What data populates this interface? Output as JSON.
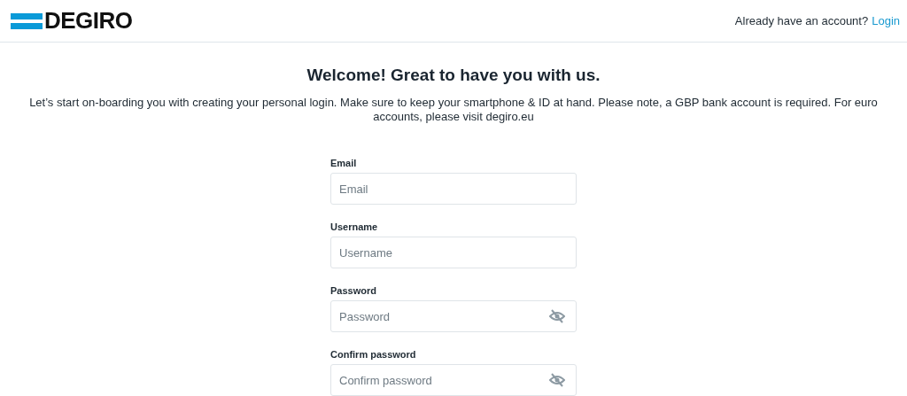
{
  "header": {
    "logo": "DEGIRO",
    "account_prompt": "Already have an account?",
    "login_link": "Login"
  },
  "title": "Welcome! Great to have you with us.",
  "intro": "Let’s start on-boarding you with creating your personal login. Make sure to keep your smartphone & ID at hand. Please note, a GBP bank account is required. For euro accounts, please visit degiro.eu",
  "fields": [
    {
      "label": "Email",
      "placeholder": "Email",
      "kind": "text"
    },
    {
      "label": "Username",
      "placeholder": "Username",
      "kind": "text"
    },
    {
      "label": "Password",
      "placeholder": "Password",
      "kind": "password"
    },
    {
      "label": "Confirm password",
      "placeholder": "Confirm password",
      "kind": "password"
    }
  ]
}
